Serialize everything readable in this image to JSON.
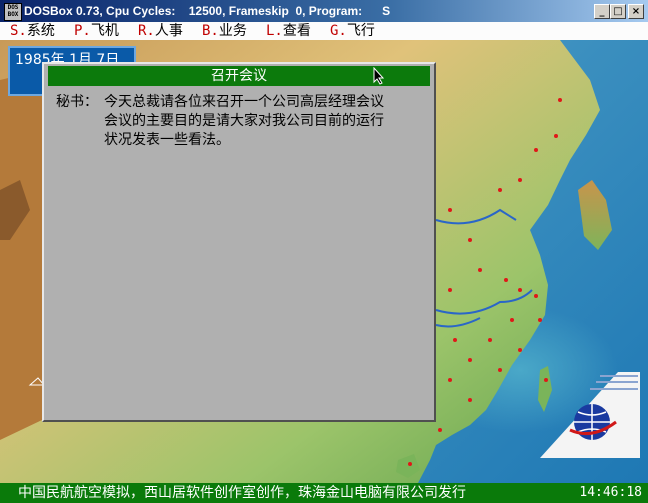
{
  "window": {
    "icon_text": "DOS BOX",
    "title": "DOSBox 0.73, Cpu Cycles:    12500, Frameskip  0, Program:      S",
    "buttons": {
      "minimize": "_",
      "maximize": "□",
      "close": "×"
    }
  },
  "menu": [
    {
      "key": "S.",
      "label": "系统"
    },
    {
      "key": "P.",
      "label": "飞机"
    },
    {
      "key": "R.",
      "label": "人事"
    },
    {
      "key": "B.",
      "label": "业务"
    },
    {
      "key": "L.",
      "label": "查看"
    },
    {
      "key": "G.",
      "label": "飞行"
    }
  ],
  "date": "1985年 1月 7日",
  "dialog": {
    "title": "召开会议",
    "speaker": "秘书：",
    "lines": [
      "今天总裁请各位来召开一个公司高层经理会议",
      "会议的主要目的是请大家对我公司目前的运行",
      "状况发表一些看法。"
    ]
  },
  "status": {
    "text": "中国民航航空模拟，西山居软件创作室创作，珠海金山电脑有限公司发行",
    "clock": "14:46:18"
  },
  "colors": {
    "menu_key": "#c00000",
    "dialog_title_bg": "#0c7a0c",
    "status_bg": "#0a7a0a",
    "date_panel_bg": "#0a5aa8"
  },
  "icons": [
    "dosbox-icon",
    "minimize-icon",
    "maximize-icon",
    "close-icon",
    "mouse-cursor-icon",
    "airline-logo-icon"
  ]
}
